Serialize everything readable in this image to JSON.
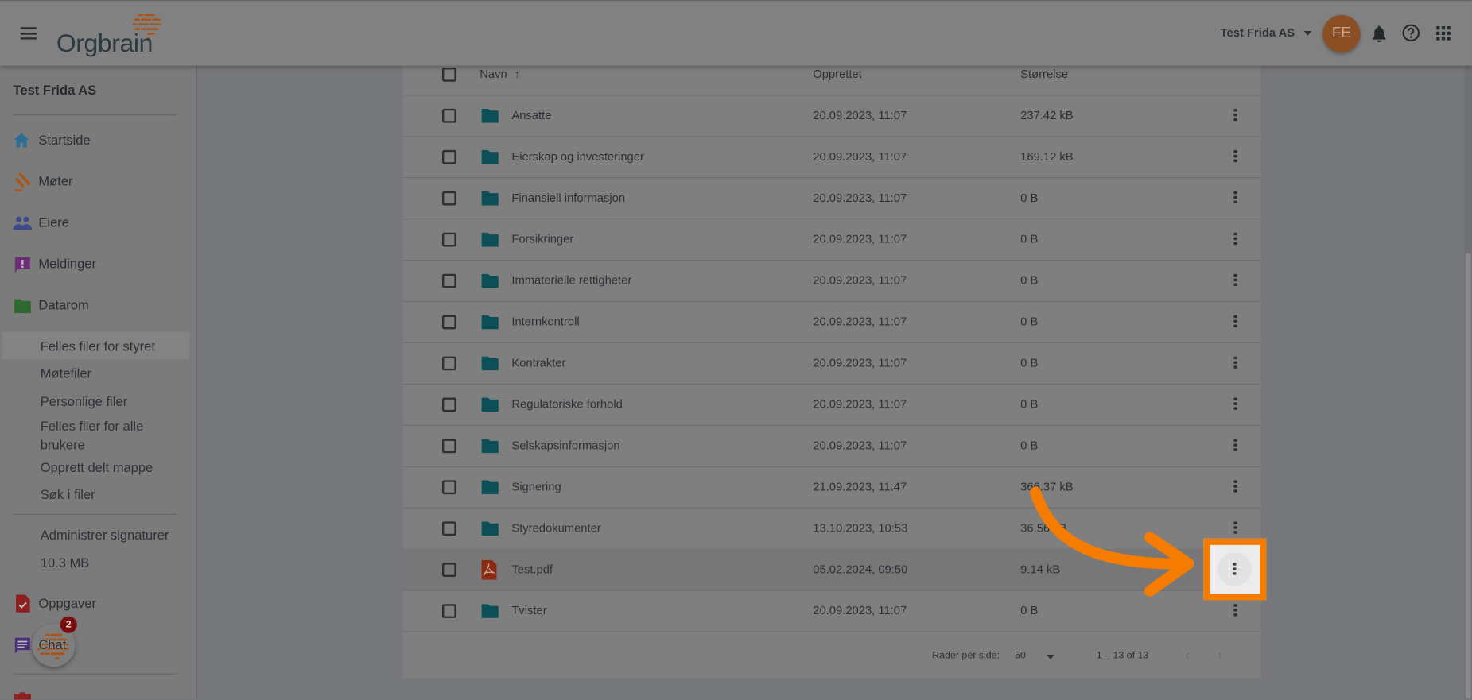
{
  "topbar": {
    "logo_text": "Orgbrain",
    "company_selector": "Test Frida AS",
    "avatar_initials": "FE"
  },
  "sidebar": {
    "company": "Test Frida AS",
    "nav": [
      {
        "label": "Startside",
        "icon": "home-icon",
        "color": "#2a6f97"
      },
      {
        "label": "Møter",
        "icon": "gavel-icon",
        "color": "#a8571a"
      },
      {
        "label": "Eiere",
        "icon": "people-icon",
        "color": "#3c4a8c"
      },
      {
        "label": "Meldinger",
        "icon": "message-alert-icon",
        "color": "#6a2f72"
      },
      {
        "label": "Datarom",
        "icon": "folder-icon",
        "color": "#2f6a30"
      }
    ],
    "datarom_items": [
      {
        "label": "Felles filer for styret",
        "active": true
      },
      {
        "label": "Møtefiler"
      },
      {
        "label": "Personlige filer"
      },
      {
        "label": "Felles filer for alle brukere"
      },
      {
        "label": "Opprett delt mappe"
      },
      {
        "label": "Søk i filer"
      }
    ],
    "admin_signatures": "Administrer signaturer",
    "storage_used": "10.3 MB",
    "nav2": [
      {
        "label": "Oppgaver",
        "icon": "task-icon",
        "color": "#8c1f1f"
      },
      {
        "label": "Chat",
        "icon": "chat-icon",
        "color": "#4a2f7a"
      }
    ],
    "chat_badge": "2"
  },
  "table": {
    "columns": {
      "name": "Navn",
      "created": "Opprettet",
      "size": "Størrelse"
    },
    "sort": "name-ascending",
    "rows": [
      {
        "name": "Ansatte",
        "type": "folder",
        "created": "20.09.2023, 11:07",
        "size": "237.42 kB"
      },
      {
        "name": "Eierskap og investeringer",
        "type": "folder",
        "created": "20.09.2023, 11:07",
        "size": "169.12 kB"
      },
      {
        "name": "Finansiell informasjon",
        "type": "folder",
        "created": "20.09.2023, 11:07",
        "size": "0 B"
      },
      {
        "name": "Forsikringer",
        "type": "folder",
        "created": "20.09.2023, 11:07",
        "size": "0 B"
      },
      {
        "name": "Immaterielle rettigheter",
        "type": "folder",
        "created": "20.09.2023, 11:07",
        "size": "0 B"
      },
      {
        "name": "Internkontroll",
        "type": "folder",
        "created": "20.09.2023, 11:07",
        "size": "0 B"
      },
      {
        "name": "Kontrakter",
        "type": "folder",
        "created": "20.09.2023, 11:07",
        "size": "0 B"
      },
      {
        "name": "Regulatoriske forhold",
        "type": "folder",
        "created": "20.09.2023, 11:07",
        "size": "0 B"
      },
      {
        "name": "Selskapsinformasjon",
        "type": "folder",
        "created": "20.09.2023, 11:07",
        "size": "0 B"
      },
      {
        "name": "Signering",
        "type": "folder",
        "created": "21.09.2023, 11:47",
        "size": "366.37 kB"
      },
      {
        "name": "Styredokumenter",
        "type": "folder",
        "created": "13.10.2023, 10:53",
        "size": "36.56 kB"
      },
      {
        "name": "Test.pdf",
        "type": "pdf",
        "created": "05.02.2024, 09:50",
        "size": "9.14 kB",
        "highlighted": true
      },
      {
        "name": "Tvister",
        "type": "folder",
        "created": "20.09.2023, 11:07",
        "size": "0 B"
      }
    ],
    "pagination": {
      "rows_per_page_label": "Rader per side:",
      "rows_per_page": "50",
      "range": "1 – 13 of 13"
    }
  },
  "colors": {
    "accent": "#f57c00",
    "folder": "#0d4f57",
    "pdf": "#8a2a12",
    "avatar": "#8a4f22"
  }
}
